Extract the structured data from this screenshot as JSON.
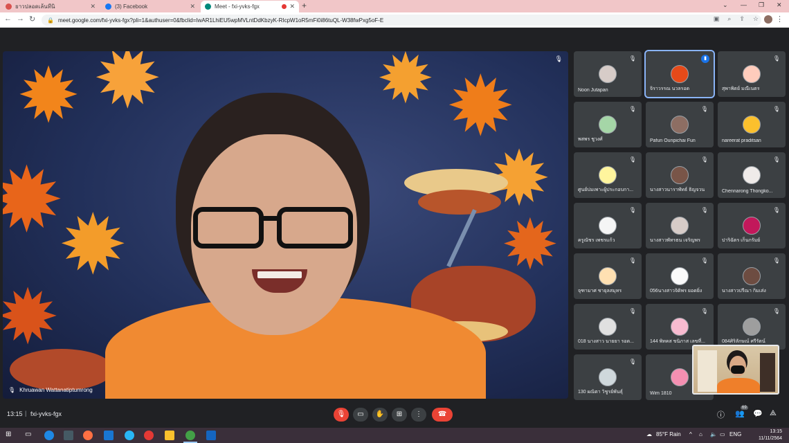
{
  "browser": {
    "tabs": [
      {
        "title": "ยาวปลอดเล้นทีนิ",
        "favicon_color": "#d9534f",
        "active": false
      },
      {
        "title": "(3) Facebook",
        "favicon_color": "#1877f2",
        "active": false
      },
      {
        "title": "Meet - fxi-yvks-fgx",
        "favicon_color": "#00897b",
        "active": true
      }
    ],
    "url": "meet.google.com/fxi-yvks-fgx?pli=1&authuser=0&fbclid=IwAR1LhiEU5wpMVLntDdKbzyK-RIcpW1oR5mFi0i86tuQL-W38fwPxg5oF-E"
  },
  "main_speaker": {
    "name": "Khruawan Wattanatiptumrong"
  },
  "participants": [
    {
      "name": "Noon Jutapan",
      "avatar_color": "#d7ccc8"
    },
    {
      "name": "จิราวรรณ นวลรอด",
      "avatar_color": "#e64a19",
      "speaking": true
    },
    {
      "name": "สุพาพิตย์ มณีเนตร",
      "avatar_color": "#ffccbc"
    },
    {
      "name": "พสพร ชูวงศ์",
      "avatar_color": "#a5d6a7"
    },
    {
      "name": "Pafun Ounpichai Fun",
      "avatar_color": "#8d6e63"
    },
    {
      "name": "nareerat praditsan",
      "avatar_color": "#fbc02d"
    },
    {
      "name": "ศูนย์บ่มเพาะผู้ประกอบกา...",
      "avatar_color": "#fff59d"
    },
    {
      "name": "นางสาวนาราพัทธ์ ธิญจวน",
      "avatar_color": "#795548"
    },
    {
      "name": "Chennarong Thongko...",
      "avatar_color": "#efebe9"
    },
    {
      "name": "ครูณัชร เพชรแก้ว",
      "avatar_color": "#f5f5f5"
    },
    {
      "name": "นางสาวพัทรธน เจริญพร",
      "avatar_color": "#d7ccc8"
    },
    {
      "name": "ปาริฉัตร เก็นกรัมย์",
      "avatar_color": "#c2185b"
    },
    {
      "name": "จุฑามาศ ชายุลสมุทร",
      "avatar_color": "#ffe0b2"
    },
    {
      "name": "056นางสาวจิติพร ยอดยิ่ง",
      "avatar_color": "#fafafa"
    },
    {
      "name": "นางสาวปรีณา กิมเส่ง",
      "avatar_color": "#6d4c41"
    },
    {
      "name": "018 นางสาว นายยา รอด...",
      "avatar_color": "#e0e0e0"
    },
    {
      "name": "144 พิทคส ขนิภาส เลขที่...",
      "avatar_color": "#f8bbd0"
    },
    {
      "name": "084ศิริลักษณ์ ศรีรัตน์",
      "avatar_color": "#9e9e9e"
    },
    {
      "name": "130 ผณิตา วิชูรย์พันธุ์",
      "avatar_color": "#cfd8dc"
    },
    {
      "name": "Wim 1810",
      "avatar_color": "#f48fb1"
    }
  ],
  "bottom_bar": {
    "time": "13:15",
    "separator": "|",
    "meeting_code": "fxi-yvks-fgx",
    "participant_count": "69"
  },
  "taskbar": {
    "weather": "85°F Rain",
    "language": "ENG",
    "time": "13:15",
    "date": "11/11/2564"
  }
}
